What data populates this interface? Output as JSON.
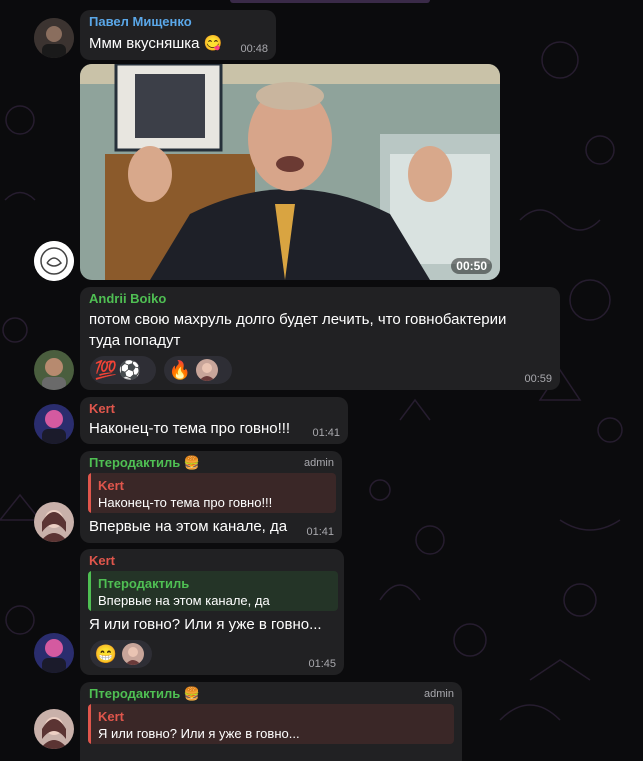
{
  "colors": {
    "background": "#0b0b0d",
    "bubble": "#212123",
    "name_blue": "#5aa7e8",
    "name_green": "#4fbf53",
    "name_red": "#e0564c"
  },
  "messages": [
    {
      "author": "Павел Мищенко",
      "text": "Ммм вкусняшка",
      "emoji": "😋",
      "time": "00:48"
    },
    {
      "video_time": "00:50"
    },
    {
      "author": "Andrii Boiko",
      "text_line1": "потом свою махруль долго будет лечить, что говнобактерии",
      "text_line2": "туда попадут",
      "time": "00:59",
      "reactions": [
        {
          "emoji": "💯"
        },
        {
          "emoji": "⚽"
        },
        {
          "emoji": "🔥"
        }
      ]
    },
    {
      "author": "Kert",
      "text": "Наконец-то тема про говно!!!",
      "time": "01:41"
    },
    {
      "author": "Птеродактиль",
      "author_emoji": "🍔",
      "badge": "admin",
      "reply_author": "Kert",
      "reply_text": "Наконец-то тема про говно!!!",
      "text": "Впервые на этом канале, да",
      "time": "01:41"
    },
    {
      "author": "Kert",
      "reply_author": "Птеродактиль",
      "reply_text": "Впервые на этом канале, да",
      "text": "Я или говно? Или я уже в говно...",
      "time": "01:45",
      "reaction_emoji": "😁"
    },
    {
      "author": "Птеродактиль",
      "author_emoji": "🍔",
      "badge": "admin",
      "reply_author": "Kert",
      "reply_text": "Я или говно? Или я уже в говно..."
    }
  ]
}
